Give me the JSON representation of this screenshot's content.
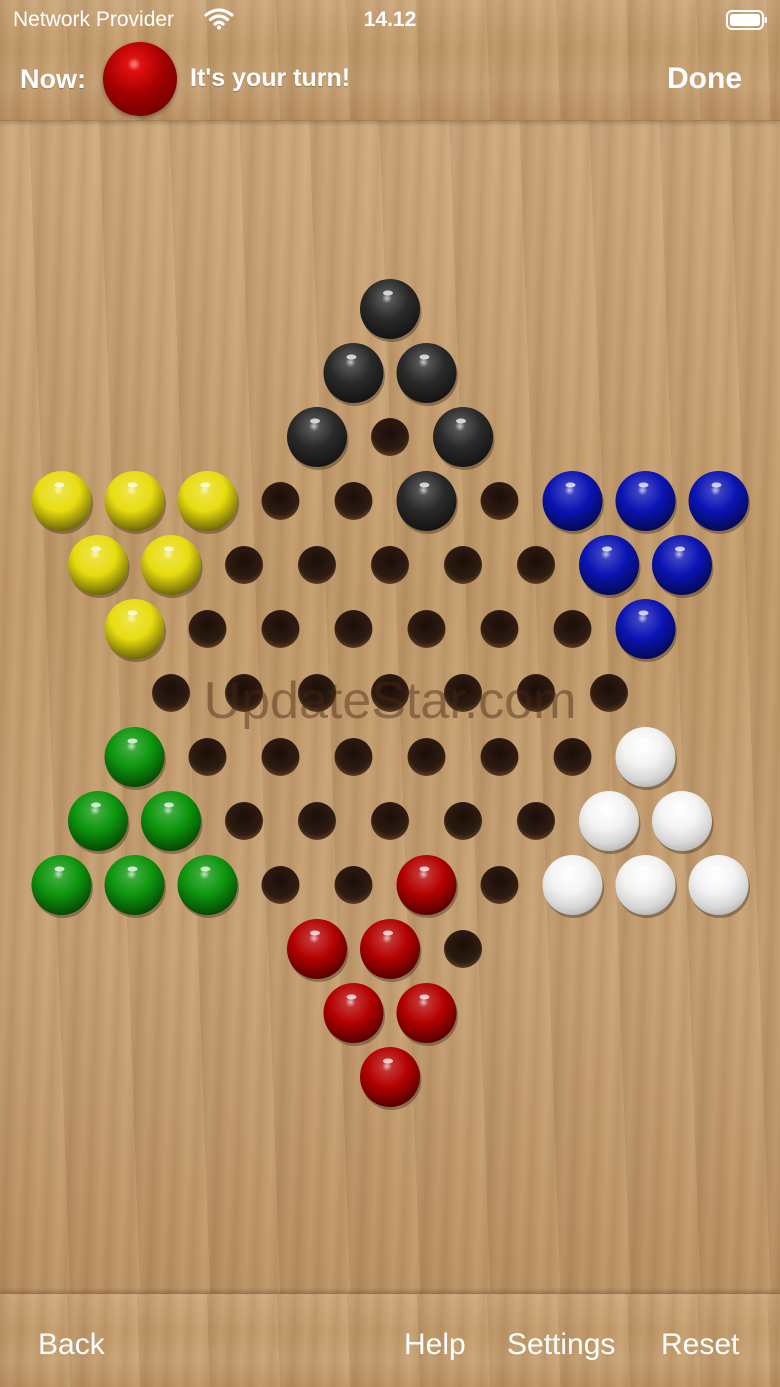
{
  "status_bar": {
    "carrier": "Network Provider",
    "time": "14.12",
    "wifi_icon": "wifi-icon",
    "battery_icon": "battery-full-icon"
  },
  "header": {
    "now_label": "Now:",
    "current_player_color": "red",
    "turn_text": "It's your turn!",
    "done_label": "Done"
  },
  "board": {
    "type": "chinese-checkers",
    "colors": {
      "black": "#2a2a2a",
      "blue": "#0a14b4",
      "yellow": "#e8dc10",
      "green": "#0c960c",
      "white": "#f2f2f2",
      "red": "#b40000",
      "hole": "#2c1a10"
    },
    "rows": [
      [
        "black"
      ],
      [
        "black",
        "black"
      ],
      [
        "black",
        "empty",
        "black"
      ],
      [
        "yellow",
        "yellow",
        "yellow",
        "empty",
        "empty",
        "black",
        "empty",
        "blue",
        "blue",
        "blue"
      ],
      [
        "yellow",
        "yellow",
        "empty",
        "empty",
        "empty",
        "empty",
        "empty",
        "blue",
        "blue"
      ],
      [
        "yellow",
        "empty",
        "empty",
        "empty",
        "empty",
        "empty",
        "empty",
        "blue"
      ],
      [
        "empty",
        "empty",
        "empty",
        "empty",
        "empty",
        "empty",
        "empty"
      ],
      [
        "green",
        "empty",
        "empty",
        "empty",
        "empty",
        "empty",
        "empty",
        "white"
      ],
      [
        "green",
        "green",
        "empty",
        "empty",
        "empty",
        "empty",
        "empty",
        "white",
        "white"
      ],
      [
        "green",
        "green",
        "green",
        "empty",
        "empty",
        "red",
        "empty",
        "white",
        "white",
        "white"
      ],
      [
        "red",
        "red",
        "empty"
      ],
      [
        "red",
        "red"
      ],
      [
        "red"
      ]
    ]
  },
  "watermark": "UpdateStar.com",
  "footer": {
    "back_label": "Back",
    "help_label": "Help",
    "settings_label": "Settings",
    "reset_label": "Reset"
  }
}
